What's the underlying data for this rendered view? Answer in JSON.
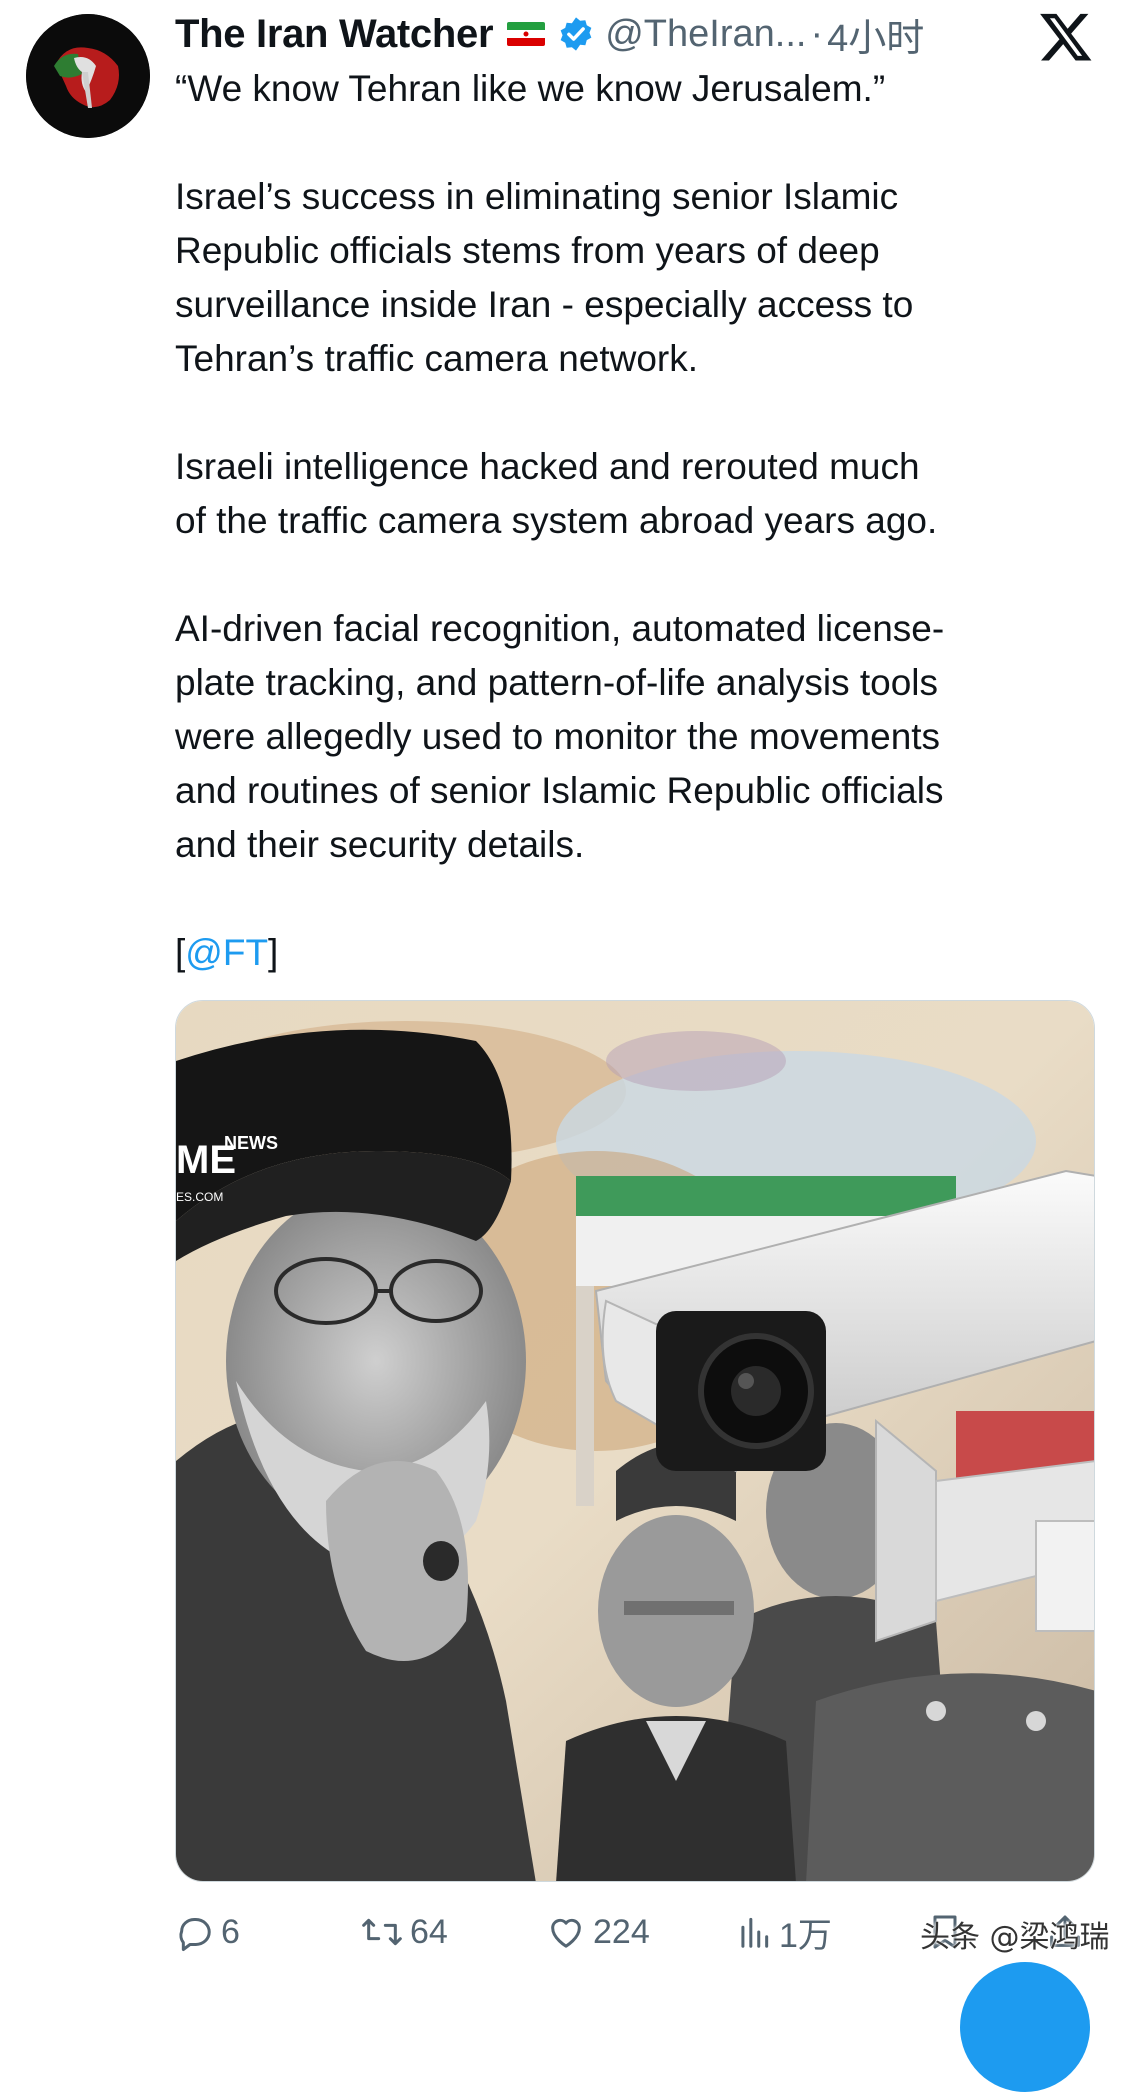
{
  "account": {
    "display_name": "The Iran Watcher",
    "flag_icon": "iran-flag-icon",
    "verified_icon": "verified-badge-icon",
    "handle": "@TheIran...",
    "separator": "·",
    "time": "4小时"
  },
  "platform_logo": "x-logo",
  "tweet": {
    "p1": "“We know Tehran like we know Jerusalem.”",
    "p2": "Israel’s success in eliminating senior Islamic\nRepublic officials stems from years of deep\nsurveillance inside Iran - especially access to\nTehran’s traffic camera network.",
    "p3": "Israeli intelligence hacked and rerouted much\nof the traffic camera system abroad years ago.",
    "p4": "AI-driven facial recognition, automated license-\nplate tracking, and pattern-of-life analysis tools\nwere allegedly used to monitor the movements\nand routines of senior Islamic Republic officials\nand their security details.",
    "source_open": "[",
    "source_mention": "@FT",
    "source_close": "]"
  },
  "media": {
    "overlay_logo_text": "ME",
    "overlay_news_text": "NEWS",
    "overlay_domain_text": "ES.COM"
  },
  "actions": {
    "replies": "6",
    "reposts": "64",
    "likes": "224",
    "views": "1万"
  },
  "watermark": "头条 @梁鸿瑞",
  "colors": {
    "text": "#0f1419",
    "secondary": "#536471",
    "accent": "#1d9bf0"
  }
}
